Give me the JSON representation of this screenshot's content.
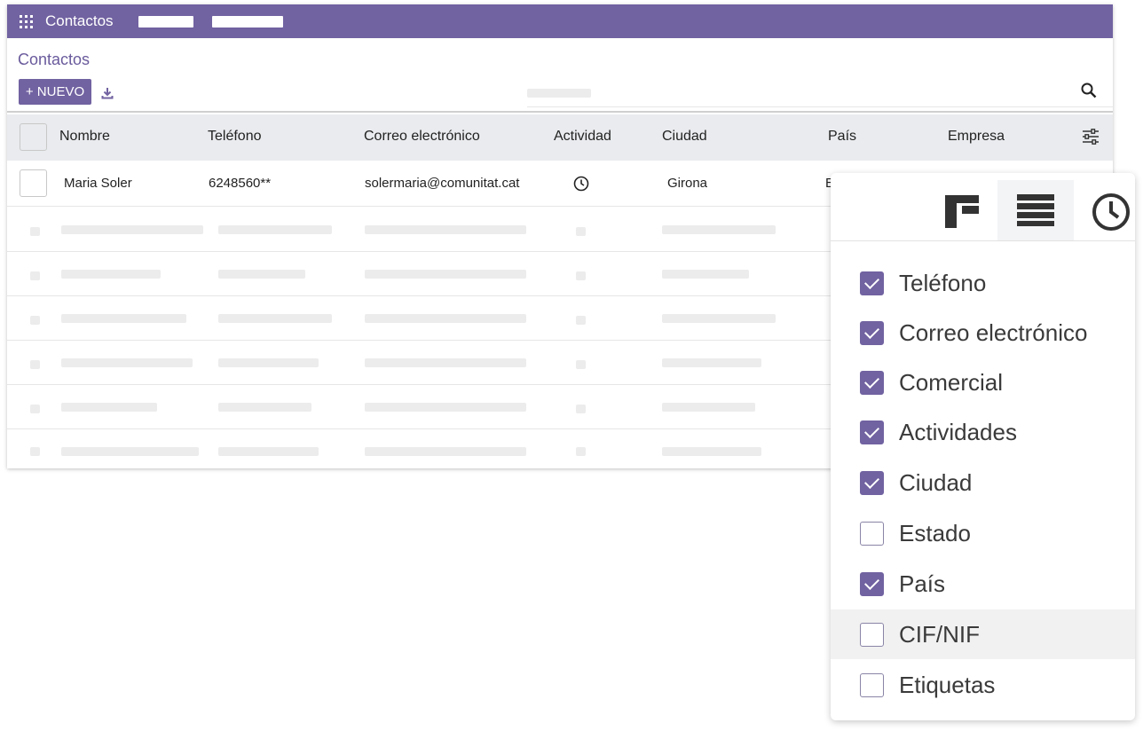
{
  "topbar": {
    "app_title": "Contactos"
  },
  "control": {
    "breadcrumb": "Contactos",
    "new_button": "+ NUEVO"
  },
  "table": {
    "columns": [
      "Nombre",
      "Teléfono",
      "Correo electrónico",
      "Actividad",
      "Ciudad",
      "País",
      "Empresa"
    ],
    "rows": [
      {
        "name": "Maria Soler",
        "phone": "6248560**",
        "email": "solermaria@comunitat.cat",
        "activity_icon": "clock-icon",
        "city": "Girona",
        "country": "E"
      }
    ]
  },
  "column_chooser": {
    "views": [
      "kanban-icon",
      "list-icon",
      "activity-clock-icon"
    ],
    "active_view": "list-icon",
    "options": [
      {
        "label": "Teléfono",
        "checked": true
      },
      {
        "label": "Correo electrónico",
        "checked": true
      },
      {
        "label": "Comercial",
        "checked": true
      },
      {
        "label": "Actividades",
        "checked": true
      },
      {
        "label": "Ciudad",
        "checked": true
      },
      {
        "label": "Estado",
        "checked": false
      },
      {
        "label": "País",
        "checked": true
      },
      {
        "label": "CIF/NIF",
        "checked": false
      },
      {
        "label": "Etiquetas",
        "checked": false
      }
    ]
  },
  "colors": {
    "brand": "#7162a1",
    "header_bg": "#e9ebee",
    "placeholder": "#ececec"
  }
}
